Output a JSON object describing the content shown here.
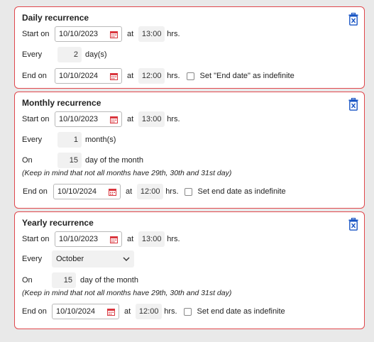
{
  "labels": {
    "start_on": "Start on",
    "at": "at",
    "hrs": "hrs.",
    "every": "Every",
    "end_on": "End on",
    "on": "On",
    "day_of_month": "day of the month"
  },
  "daily": {
    "title": "Daily recurrence",
    "start_date": "10/10/2023",
    "start_time": "13:00",
    "every_value": "2",
    "every_unit": "day(s)",
    "end_date": "10/10/2024",
    "end_time": "12:00",
    "indefinite_label": "Set \"End date\" as indefinite"
  },
  "monthly": {
    "title": "Monthly recurrence",
    "start_date": "10/10/2023",
    "start_time": "13:00",
    "every_value": "1",
    "every_unit": "month(s)",
    "on_value": "15",
    "note": "(Keep in mind that not all months have 29th, 30th and 31st day)",
    "end_date": "10/10/2024",
    "end_time": "12:00",
    "indefinite_label": "Set end date as indefinite"
  },
  "yearly": {
    "title": "Yearly recurrence",
    "start_date": "10/10/2023",
    "start_time": "13:00",
    "every_month": "October",
    "on_value": "15",
    "note": "(Keep in mind that not all months have 29th, 30th and 31st day)",
    "end_date": "10/10/2024",
    "end_time": "12:00",
    "indefinite_label": "Set end date as indefinite"
  },
  "icons": {
    "delete": "trash-icon",
    "calendar": "calendar-icon",
    "chevron": "chevron-down-icon"
  },
  "colors": {
    "panel_border": "#e0474c",
    "delete_icon": "#1a56c4",
    "calendar_icon": "#d9363e"
  }
}
